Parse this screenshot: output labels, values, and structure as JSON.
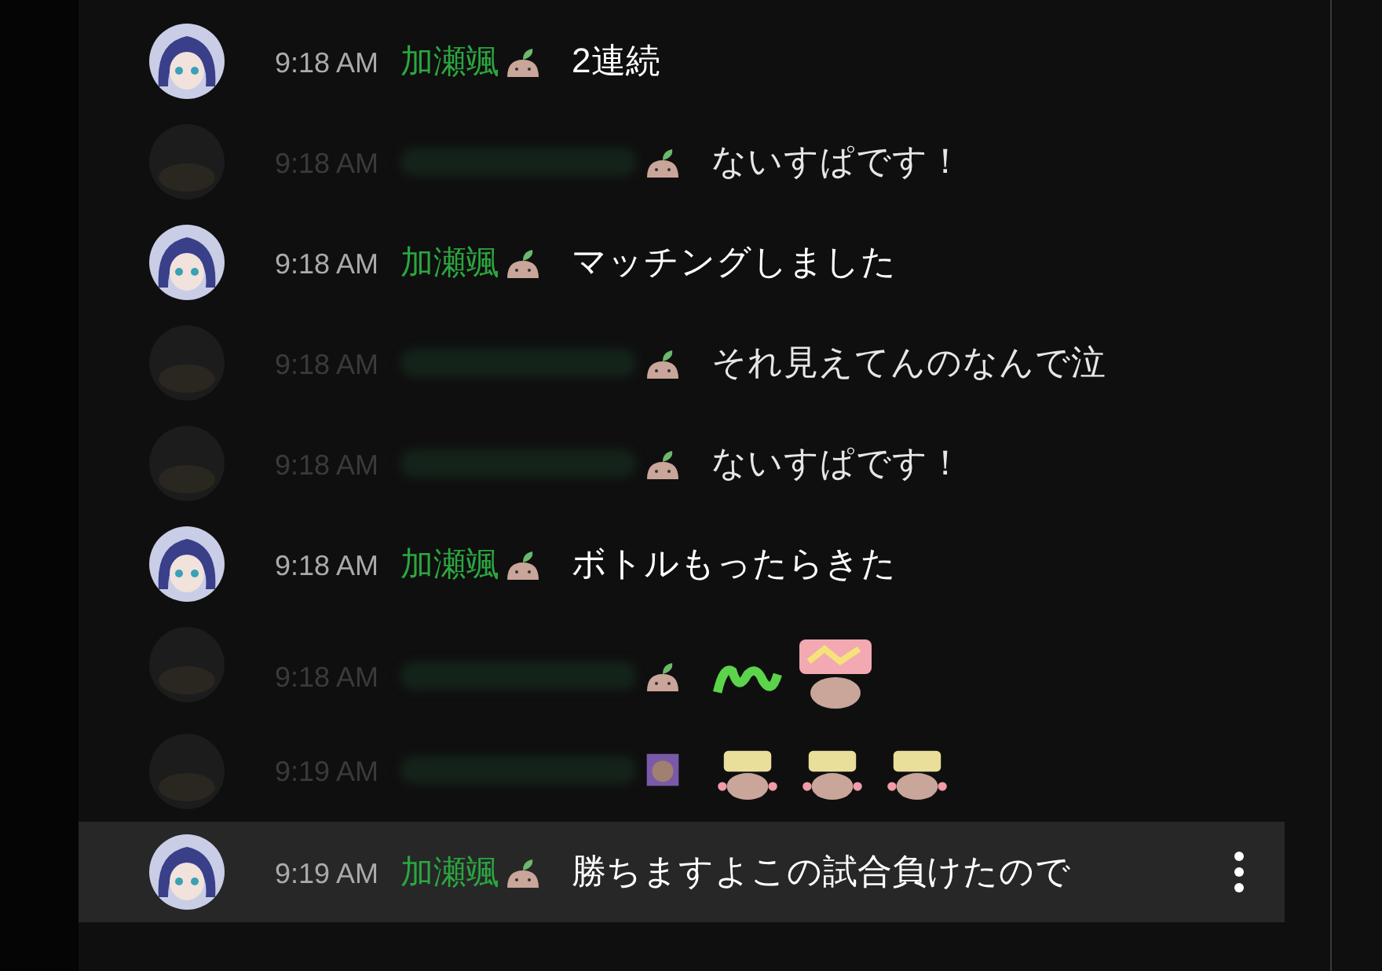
{
  "messages": [
    {
      "avatar": {
        "kind": "character"
      },
      "time": "9:18 AM",
      "name": "加瀬颯",
      "name_blurred": false,
      "badge": {
        "kind": "sprout"
      },
      "faded": false,
      "selected": false,
      "parts": [
        {
          "kind": "text",
          "text": "2連続"
        }
      ]
    },
    {
      "avatar": {
        "kind": "photo"
      },
      "time": "9:18 AM",
      "name_blurred": true,
      "badge": {
        "kind": "sprout"
      },
      "faded": true,
      "selected": false,
      "parts": [
        {
          "kind": "text",
          "text": "ないすぱです！"
        }
      ]
    },
    {
      "avatar": {
        "kind": "character"
      },
      "time": "9:18 AM",
      "name": "加瀬颯",
      "name_blurred": false,
      "badge": {
        "kind": "sprout"
      },
      "faded": false,
      "selected": false,
      "parts": [
        {
          "kind": "text",
          "text": "マッチングしました"
        }
      ]
    },
    {
      "avatar": {
        "kind": "photo"
      },
      "time": "9:18 AM",
      "name_blurred": true,
      "badge": {
        "kind": "sprout"
      },
      "faded": true,
      "selected": false,
      "parts": [
        {
          "kind": "text",
          "text": "それ見えてんのなんで泣"
        }
      ]
    },
    {
      "avatar": {
        "kind": "photo"
      },
      "time": "9:18 AM",
      "name_blurred": true,
      "badge": {
        "kind": "sprout"
      },
      "faded": true,
      "selected": false,
      "parts": [
        {
          "kind": "text",
          "text": "ないすぱです！"
        }
      ]
    },
    {
      "avatar": {
        "kind": "character"
      },
      "time": "9:18 AM",
      "name": "加瀬颯",
      "name_blurred": false,
      "badge": {
        "kind": "sprout"
      },
      "faded": false,
      "selected": false,
      "parts": [
        {
          "kind": "text",
          "text": "ボトルもったらきた"
        }
      ]
    },
    {
      "avatar": {
        "kind": "photo"
      },
      "time": "9:18 AM",
      "name_blurred": true,
      "badge": {
        "kind": "sprout"
      },
      "faded": true,
      "selected": false,
      "parts": [
        {
          "kind": "word-sticker"
        },
        {
          "kind": "pink-sticker"
        }
      ]
    },
    {
      "avatar": {
        "kind": "photo"
      },
      "time": "9:19 AM",
      "name_blurred": true,
      "badge": {
        "kind": "member"
      },
      "faded": true,
      "selected": false,
      "parts": [
        {
          "kind": "nice-sticker"
        },
        {
          "kind": "nice-sticker"
        },
        {
          "kind": "nice-sticker"
        }
      ]
    },
    {
      "avatar": {
        "kind": "character"
      },
      "time": "9:19 AM",
      "name": "加瀬颯",
      "name_blurred": false,
      "badge": {
        "kind": "sprout"
      },
      "faded": false,
      "selected": true,
      "parts": [
        {
          "kind": "text",
          "text": "勝ちますよこの試合負けたので"
        }
      ]
    }
  ]
}
